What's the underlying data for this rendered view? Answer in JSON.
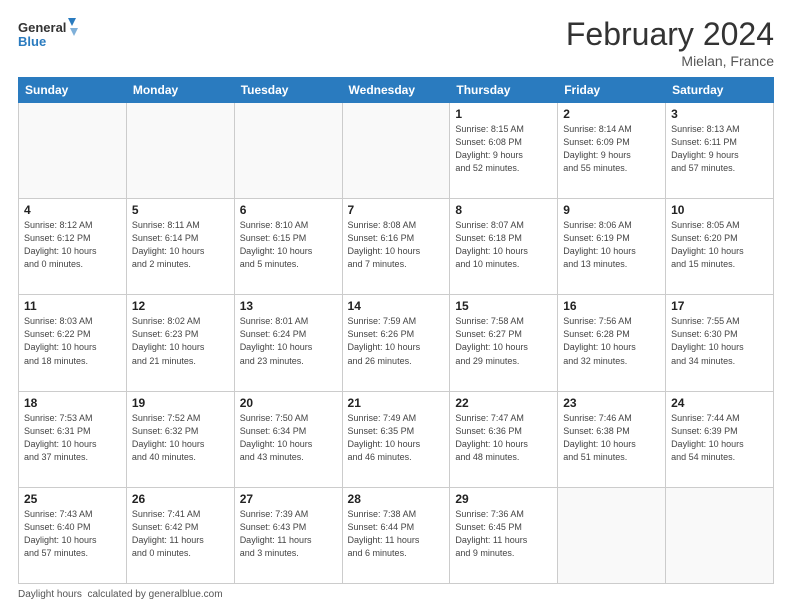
{
  "header": {
    "logo_general": "General",
    "logo_blue": "Blue",
    "month_title": "February 2024",
    "location": "Mielan, France"
  },
  "days_of_week": [
    "Sunday",
    "Monday",
    "Tuesday",
    "Wednesday",
    "Thursday",
    "Friday",
    "Saturday"
  ],
  "weeks": [
    [
      {
        "day": "",
        "info": ""
      },
      {
        "day": "",
        "info": ""
      },
      {
        "day": "",
        "info": ""
      },
      {
        "day": "",
        "info": ""
      },
      {
        "day": "1",
        "info": "Sunrise: 8:15 AM\nSunset: 6:08 PM\nDaylight: 9 hours\nand 52 minutes."
      },
      {
        "day": "2",
        "info": "Sunrise: 8:14 AM\nSunset: 6:09 PM\nDaylight: 9 hours\nand 55 minutes."
      },
      {
        "day": "3",
        "info": "Sunrise: 8:13 AM\nSunset: 6:11 PM\nDaylight: 9 hours\nand 57 minutes."
      }
    ],
    [
      {
        "day": "4",
        "info": "Sunrise: 8:12 AM\nSunset: 6:12 PM\nDaylight: 10 hours\nand 0 minutes."
      },
      {
        "day": "5",
        "info": "Sunrise: 8:11 AM\nSunset: 6:14 PM\nDaylight: 10 hours\nand 2 minutes."
      },
      {
        "day": "6",
        "info": "Sunrise: 8:10 AM\nSunset: 6:15 PM\nDaylight: 10 hours\nand 5 minutes."
      },
      {
        "day": "7",
        "info": "Sunrise: 8:08 AM\nSunset: 6:16 PM\nDaylight: 10 hours\nand 7 minutes."
      },
      {
        "day": "8",
        "info": "Sunrise: 8:07 AM\nSunset: 6:18 PM\nDaylight: 10 hours\nand 10 minutes."
      },
      {
        "day": "9",
        "info": "Sunrise: 8:06 AM\nSunset: 6:19 PM\nDaylight: 10 hours\nand 13 minutes."
      },
      {
        "day": "10",
        "info": "Sunrise: 8:05 AM\nSunset: 6:20 PM\nDaylight: 10 hours\nand 15 minutes."
      }
    ],
    [
      {
        "day": "11",
        "info": "Sunrise: 8:03 AM\nSunset: 6:22 PM\nDaylight: 10 hours\nand 18 minutes."
      },
      {
        "day": "12",
        "info": "Sunrise: 8:02 AM\nSunset: 6:23 PM\nDaylight: 10 hours\nand 21 minutes."
      },
      {
        "day": "13",
        "info": "Sunrise: 8:01 AM\nSunset: 6:24 PM\nDaylight: 10 hours\nand 23 minutes."
      },
      {
        "day": "14",
        "info": "Sunrise: 7:59 AM\nSunset: 6:26 PM\nDaylight: 10 hours\nand 26 minutes."
      },
      {
        "day": "15",
        "info": "Sunrise: 7:58 AM\nSunset: 6:27 PM\nDaylight: 10 hours\nand 29 minutes."
      },
      {
        "day": "16",
        "info": "Sunrise: 7:56 AM\nSunset: 6:28 PM\nDaylight: 10 hours\nand 32 minutes."
      },
      {
        "day": "17",
        "info": "Sunrise: 7:55 AM\nSunset: 6:30 PM\nDaylight: 10 hours\nand 34 minutes."
      }
    ],
    [
      {
        "day": "18",
        "info": "Sunrise: 7:53 AM\nSunset: 6:31 PM\nDaylight: 10 hours\nand 37 minutes."
      },
      {
        "day": "19",
        "info": "Sunrise: 7:52 AM\nSunset: 6:32 PM\nDaylight: 10 hours\nand 40 minutes."
      },
      {
        "day": "20",
        "info": "Sunrise: 7:50 AM\nSunset: 6:34 PM\nDaylight: 10 hours\nand 43 minutes."
      },
      {
        "day": "21",
        "info": "Sunrise: 7:49 AM\nSunset: 6:35 PM\nDaylight: 10 hours\nand 46 minutes."
      },
      {
        "day": "22",
        "info": "Sunrise: 7:47 AM\nSunset: 6:36 PM\nDaylight: 10 hours\nand 48 minutes."
      },
      {
        "day": "23",
        "info": "Sunrise: 7:46 AM\nSunset: 6:38 PM\nDaylight: 10 hours\nand 51 minutes."
      },
      {
        "day": "24",
        "info": "Sunrise: 7:44 AM\nSunset: 6:39 PM\nDaylight: 10 hours\nand 54 minutes."
      }
    ],
    [
      {
        "day": "25",
        "info": "Sunrise: 7:43 AM\nSunset: 6:40 PM\nDaylight: 10 hours\nand 57 minutes."
      },
      {
        "day": "26",
        "info": "Sunrise: 7:41 AM\nSunset: 6:42 PM\nDaylight: 11 hours\nand 0 minutes."
      },
      {
        "day": "27",
        "info": "Sunrise: 7:39 AM\nSunset: 6:43 PM\nDaylight: 11 hours\nand 3 minutes."
      },
      {
        "day": "28",
        "info": "Sunrise: 7:38 AM\nSunset: 6:44 PM\nDaylight: 11 hours\nand 6 minutes."
      },
      {
        "day": "29",
        "info": "Sunrise: 7:36 AM\nSunset: 6:45 PM\nDaylight: 11 hours\nand 9 minutes."
      },
      {
        "day": "",
        "info": ""
      },
      {
        "day": "",
        "info": ""
      }
    ]
  ],
  "footer": {
    "daylight_label": "Daylight hours"
  }
}
